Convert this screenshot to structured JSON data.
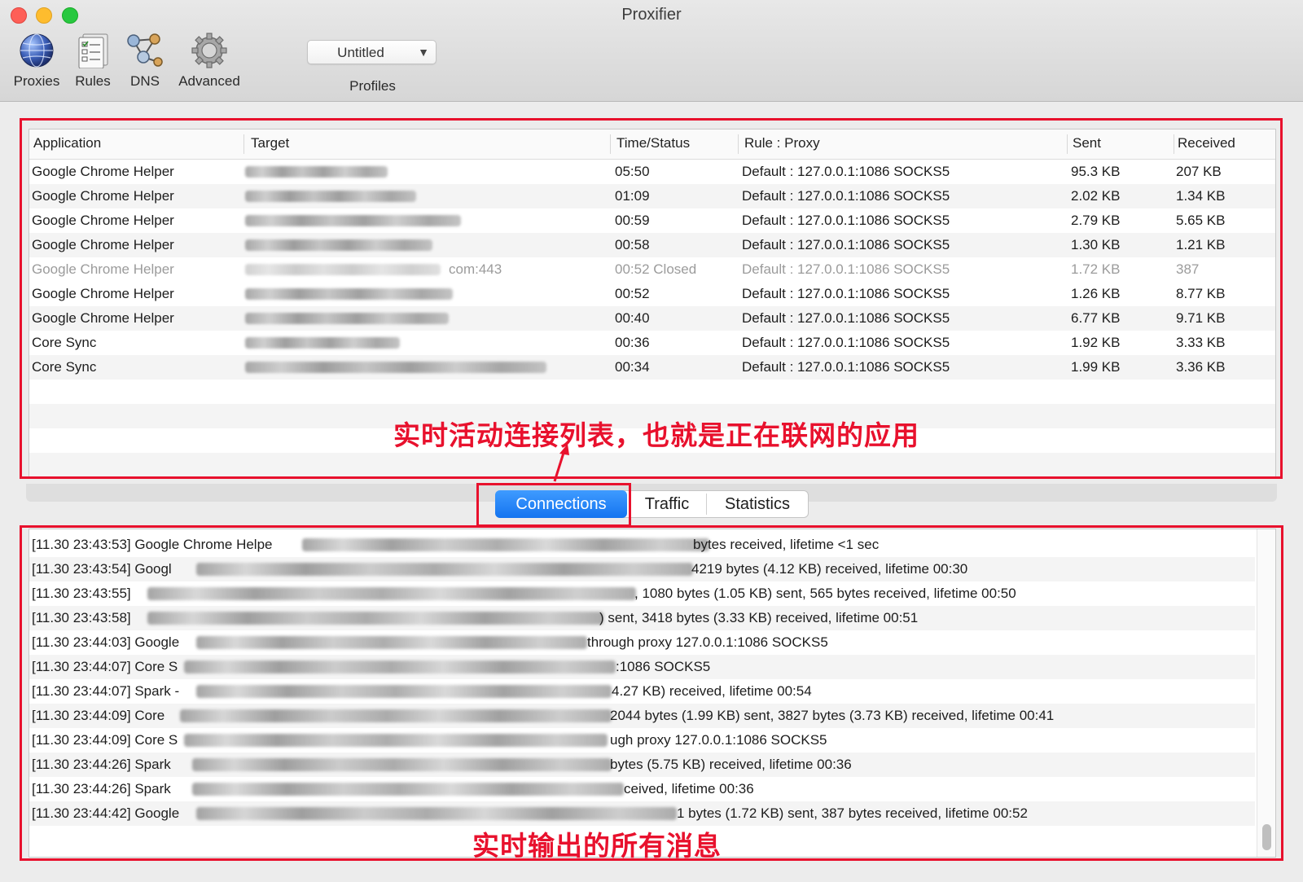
{
  "window": {
    "title": "Proxifier"
  },
  "toolbar": {
    "proxies_label": "Proxies",
    "rules_label": "Rules",
    "dns_label": "DNS",
    "advanced_label": "Advanced",
    "profile_value": "Untitled",
    "profiles_label": "Profiles"
  },
  "connections": {
    "columns": [
      "Application",
      "Target",
      "Time/Status",
      "Rule : Proxy",
      "Sent",
      "Received"
    ],
    "rows": [
      {
        "app": "Google Chrome Helper",
        "target_suffix": "",
        "time": "05:50",
        "rule": "Default : 127.0.0.1:1086 SOCKS5",
        "sent": "95.3 KB",
        "received": "207 KB",
        "closed": false
      },
      {
        "app": "Google Chrome Helper",
        "target_suffix": "",
        "time": "01:09",
        "rule": "Default : 127.0.0.1:1086 SOCKS5",
        "sent": "2.02 KB",
        "received": "1.34 KB",
        "closed": false
      },
      {
        "app": "Google Chrome Helper",
        "target_suffix": "",
        "time": "00:59",
        "rule": "Default : 127.0.0.1:1086 SOCKS5",
        "sent": "2.79 KB",
        "received": "5.65 KB",
        "closed": false
      },
      {
        "app": "Google Chrome Helper",
        "target_suffix": "",
        "time": "00:58",
        "rule": "Default : 127.0.0.1:1086 SOCKS5",
        "sent": "1.30 KB",
        "received": "1.21 KB",
        "closed": false
      },
      {
        "app": "Google Chrome Helper",
        "target_suffix": "com:443",
        "time": "00:52 Closed",
        "rule": "Default : 127.0.0.1:1086 SOCKS5",
        "sent": "1.72 KB",
        "received": "387",
        "closed": true
      },
      {
        "app": "Google Chrome Helper",
        "target_suffix": "",
        "time": "00:52",
        "rule": "Default : 127.0.0.1:1086 SOCKS5",
        "sent": "1.26 KB",
        "received": "8.77 KB",
        "closed": false
      },
      {
        "app": "Google Chrome Helper",
        "target_suffix": "",
        "time": "00:40",
        "rule": "Default : 127.0.0.1:1086 SOCKS5",
        "sent": "6.77 KB",
        "received": "9.71 KB",
        "closed": false
      },
      {
        "app": "Core Sync",
        "target_suffix": "",
        "time": "00:36",
        "rule": "Default : 127.0.0.1:1086 SOCKS5",
        "sent": "1.92 KB",
        "received": "3.33 KB",
        "closed": false
      },
      {
        "app": "Core Sync",
        "target_suffix": "",
        "time": "00:34",
        "rule": "Default : 127.0.0.1:1086 SOCKS5",
        "sent": "1.99 KB",
        "received": "3.36 KB",
        "closed": false
      }
    ]
  },
  "annotations": {
    "connections_note": "实时活动连接列表，也就是正在联网的应用",
    "log_note": "实时输出的所有消息"
  },
  "tabs": [
    "Connections",
    "Traffic",
    "Statistics"
  ],
  "log": [
    {
      "head": "[11.30 23:43:53] Google Chrome Helpe",
      "tail": "bytes received, lifetime <1 sec"
    },
    {
      "head": "[11.30 23:43:54] Googl",
      "tail": "4219 bytes (4.12 KB) received, lifetime 00:30"
    },
    {
      "head": "[11.30 23:43:55]",
      "tail": ", 1080 bytes (1.05 KB) sent, 565 bytes received, lifetime 00:50"
    },
    {
      "head": "[11.30 23:43:58]",
      "tail": ") sent, 3418 bytes (3.33 KB) received, lifetime 00:51"
    },
    {
      "head": "[11.30 23:44:03] Google",
      "tail": "through proxy 127.0.0.1:1086 SOCKS5"
    },
    {
      "head": "[11.30 23:44:07] Core S",
      "tail": ":1086 SOCKS5"
    },
    {
      "head": "[11.30 23:44:07] Spark -",
      "tail": "4.27 KB) received, lifetime 00:54"
    },
    {
      "head": "[11.30 23:44:09] Core",
      "tail": "2044 bytes (1.99 KB) sent, 3827 bytes (3.73 KB) received, lifetime 00:41"
    },
    {
      "head": "[11.30 23:44:09] Core S",
      "tail": "ugh proxy 127.0.0.1:1086 SOCKS5"
    },
    {
      "head": "[11.30 23:44:26] Spark",
      "tail": "bytes (5.75 KB) received, lifetime 00:36"
    },
    {
      "head": "[11.30 23:44:26] Spark",
      "tail": "ceived, lifetime 00:36"
    },
    {
      "head": "[11.30 23:44:42] Google",
      "tail": "1 bytes (1.72 KB) sent, 387 bytes received, lifetime 00:52"
    }
  ],
  "colors": {
    "annotation_red": "#e8112d",
    "tab_active": "#1a7cf5"
  }
}
